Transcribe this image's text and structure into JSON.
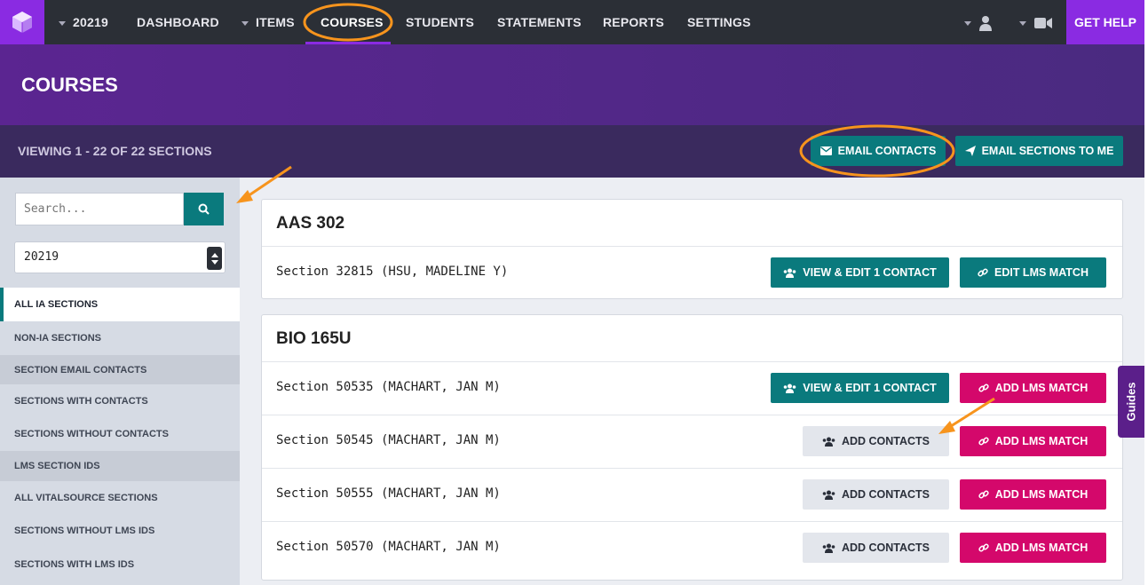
{
  "nav": {
    "term": "20219",
    "items": [
      "DASHBOARD",
      "ITEMS",
      "COURSES",
      "STUDENTS",
      "STATEMENTS",
      "REPORTS",
      "SETTINGS"
    ],
    "help": "GET HELP"
  },
  "header": {
    "title": "COURSES",
    "viewing": "VIEWING 1 - 22 OF 22 SECTIONS",
    "email_contacts": "EMAIL CONTACTS",
    "email_sections": "EMAIL SECTIONS TO ME"
  },
  "sidebar": {
    "search_placeholder": "Search...",
    "term_value": "20219",
    "items": [
      "ALL IA SECTIONS",
      "NON-IA SECTIONS",
      "SECTION EMAIL CONTACTS",
      "SECTIONS WITH CONTACTS",
      "SECTIONS WITHOUT CONTACTS",
      "LMS SECTION IDS",
      "ALL VITALSOURCE SECTIONS",
      "SECTIONS WITHOUT LMS IDS",
      "SECTIONS WITH LMS IDS"
    ]
  },
  "courses": [
    {
      "title": "AAS 302",
      "sections": [
        {
          "label": "Section 32815 (HSU, MADELINE Y)",
          "contact_btn": "VIEW & EDIT 1 CONTACT",
          "lms_btn": "EDIT LMS MATCH"
        }
      ]
    },
    {
      "title": "BIO 165U",
      "sections": [
        {
          "label": "Section 50535 (MACHART, JAN M)",
          "contact_btn": "VIEW & EDIT 1 CONTACT",
          "lms_btn": "ADD LMS MATCH"
        },
        {
          "label": "Section 50545 (MACHART, JAN M)",
          "contact_btn": "ADD CONTACTS",
          "lms_btn": "ADD LMS MATCH"
        },
        {
          "label": "Section 50555 (MACHART, JAN M)",
          "contact_btn": "ADD CONTACTS",
          "lms_btn": "ADD LMS MATCH"
        },
        {
          "label": "Section 50570 (MACHART, JAN M)",
          "contact_btn": "ADD CONTACTS",
          "lms_btn": "ADD LMS MATCH"
        }
      ]
    }
  ],
  "guides": "Guides",
  "colors": {
    "brand": "#8a2be2",
    "teal": "#0a7a7d",
    "pink": "#d4086b",
    "annotation": "#f7941d"
  },
  "icons": [
    "logo-cube-icon",
    "user-icon",
    "video-camera-icon",
    "search-icon",
    "envelope-icon",
    "paper-plane-icon",
    "users-icon",
    "link-icon"
  ]
}
